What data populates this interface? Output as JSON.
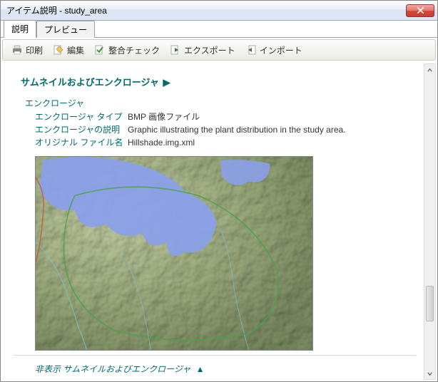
{
  "window": {
    "title": "アイテム説明 - study_area"
  },
  "tabs": {
    "description": "説明",
    "preview": "プレビュー"
  },
  "toolbar": {
    "print": "印刷",
    "edit": "編集",
    "validate": "整合チェック",
    "export": "エクスポート",
    "import": "インポート"
  },
  "section": {
    "thumbnails_title": "サムネイルおよびエンクロージャ",
    "enclosure_label": "エンクロージャ",
    "type_label": "エンクロージャ タイプ",
    "type_value": "BMP 画像ファイル",
    "desc_label": "エンクロージャの説明",
    "desc_value": "Graphic illustrating the plant distribution in the study area.",
    "orig_label": "オリジナル ファイル名",
    "orig_value": "Hillshade.img.xml",
    "hide_label": "非表示 サムネイルおよびエンクロージャ"
  }
}
